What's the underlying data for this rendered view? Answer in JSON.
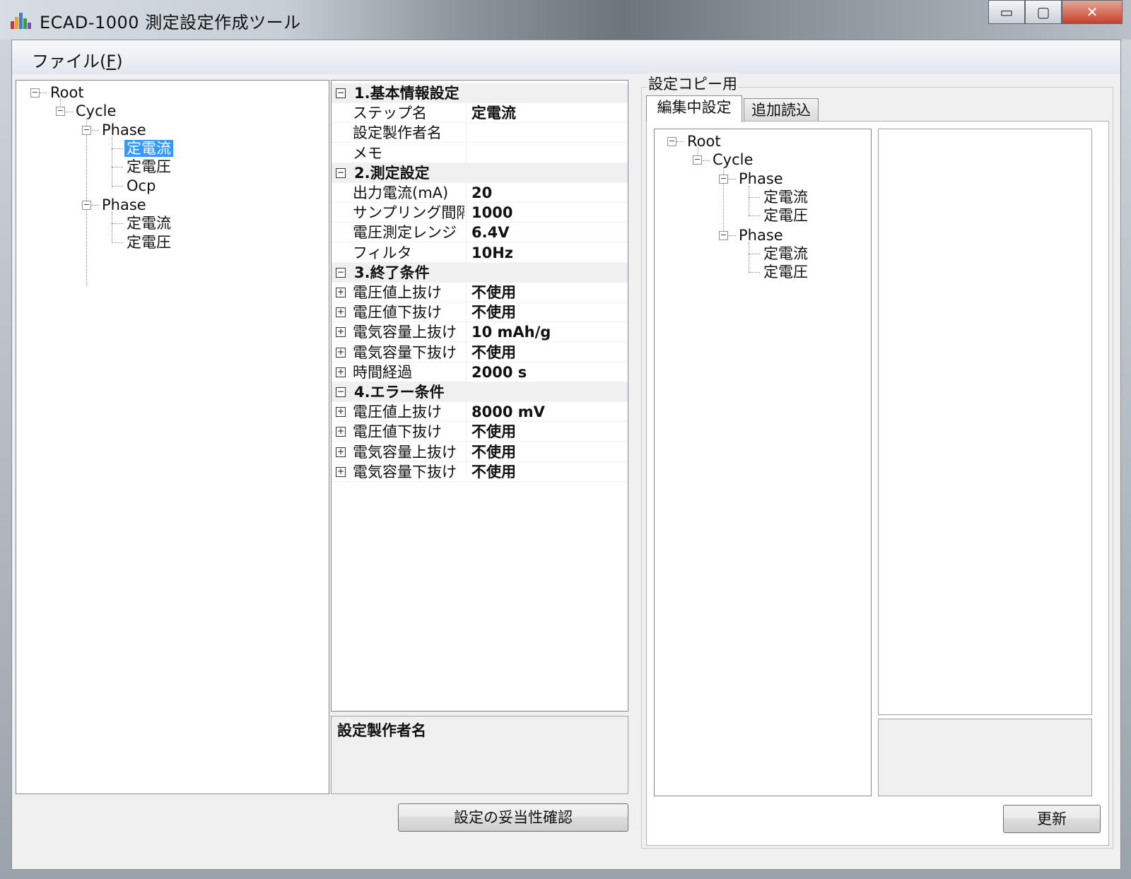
{
  "window": {
    "title": "ECAD-1000 測定設定作成ツール",
    "minimize_glyph": "▭",
    "maximize_glyph": "▢",
    "close_glyph": "✕"
  },
  "menu": {
    "file_prefix": "ファイル(",
    "file_accel": "F",
    "file_suffix": ")"
  },
  "left_tree": {
    "root": "Root",
    "cycle": "Cycle",
    "phase1": "Phase",
    "phase1_items": [
      "定電流",
      "定電圧",
      "Ocp"
    ],
    "phase2": "Phase",
    "phase2_items": [
      "定電流",
      "定電圧"
    ],
    "selected_item": "定電流"
  },
  "property_grid": {
    "rows": [
      {
        "type": "category",
        "label": "1.基本情報設定",
        "box": "⊟"
      },
      {
        "type": "prop",
        "name": "ステップ名",
        "value": "定電流"
      },
      {
        "type": "prop",
        "name": "設定製作者名",
        "value": ""
      },
      {
        "type": "prop",
        "name": "メモ",
        "value": ""
      },
      {
        "type": "category",
        "label": "2.測定設定",
        "box": "⊟"
      },
      {
        "type": "prop",
        "name": "出力電流(mA)",
        "value": "20"
      },
      {
        "type": "prop",
        "name": "サンプリング間隔(",
        "value": "1000"
      },
      {
        "type": "prop",
        "name": "電圧測定レンジ",
        "value": "6.4V"
      },
      {
        "type": "prop",
        "name": "フィルタ",
        "value": "10Hz"
      },
      {
        "type": "category",
        "label": "3.終了条件",
        "box": "⊟"
      },
      {
        "type": "expand",
        "name": "電圧値上抜け",
        "value": "不使用"
      },
      {
        "type": "expand",
        "name": "電圧値下抜け",
        "value": "不使用"
      },
      {
        "type": "expand",
        "name": "電気容量上抜け",
        "value": "10 mAh/g"
      },
      {
        "type": "expand",
        "name": "電気容量下抜け",
        "value": "不使用"
      },
      {
        "type": "expand",
        "name": "時間経過",
        "value": "2000 s"
      },
      {
        "type": "category",
        "label": "4.エラー条件",
        "box": "⊟"
      },
      {
        "type": "expand",
        "name": "電圧値上抜け",
        "value": "8000 mV"
      },
      {
        "type": "expand",
        "name": "電圧値下抜け",
        "value": "不使用"
      },
      {
        "type": "expand",
        "name": "電気容量上抜け",
        "value": "不使用"
      },
      {
        "type": "expand",
        "name": "電気容量下抜け",
        "value": "不使用"
      }
    ]
  },
  "help_panel": {
    "title": "設定製作者名"
  },
  "validate_button": "設定の妥当性確認",
  "copy_group": {
    "label": "設定コピー用",
    "tabs": [
      "編集中設定",
      "追加読込"
    ],
    "tree": {
      "root": "Root",
      "cycle": "Cycle",
      "phase1": "Phase",
      "phase1_items": [
        "定電流",
        "定電圧"
      ],
      "phase2": "Phase",
      "phase2_items": [
        "定電流",
        "定電圧"
      ]
    },
    "update_button": "更新"
  },
  "colors": {
    "selection": "#3399ff",
    "panel_border": "#828790"
  }
}
